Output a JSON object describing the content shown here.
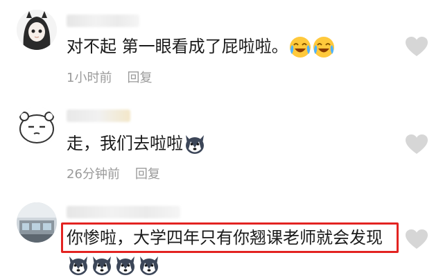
{
  "comments": [
    {
      "text": "对不起 第一眼看成了屁啦啦。",
      "emojis": [
        "laugh-cry-emoji",
        "laugh-cry-emoji"
      ],
      "time": "1小时前",
      "reply": "回复"
    },
    {
      "text": "走，我们去啦啦",
      "emojis": [
        "husky-dog-emoji"
      ],
      "time": "26分钟前",
      "reply": "回复"
    },
    {
      "text": "你惨啦，大学四年只有你翘课老师就会发现",
      "emojis": [
        "husky-dog-emoji",
        "husky-dog-emoji",
        "husky-dog-emoji",
        "husky-dog-emoji"
      ],
      "highlighted": true
    }
  ],
  "colors": {
    "highlight": "#e32321",
    "meta": "#9a9a9a",
    "heart": "#d6d6d6"
  },
  "icons": [
    "heart-icon"
  ]
}
